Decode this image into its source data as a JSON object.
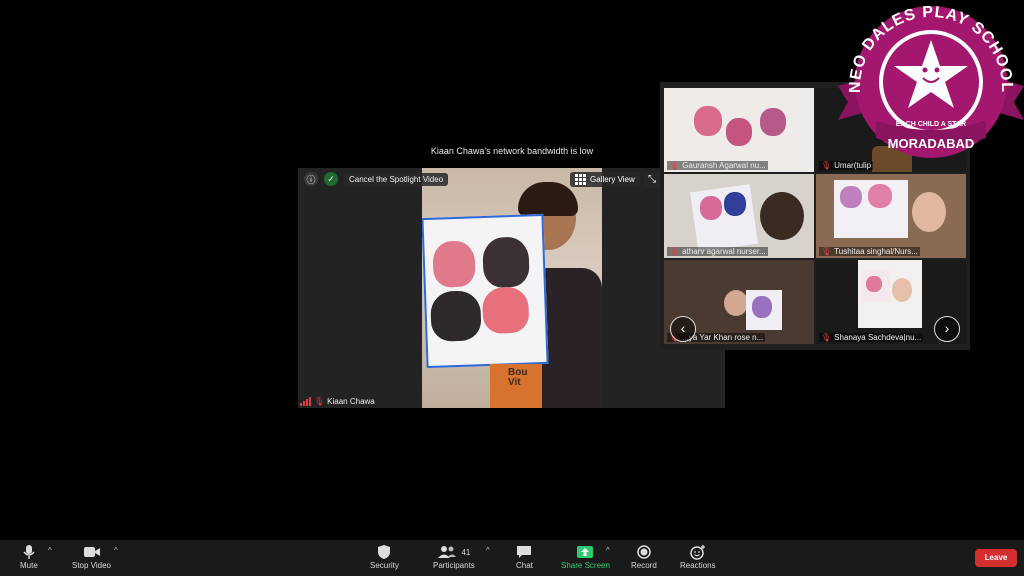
{
  "notice": "Kiaan Chawa's network bandwidth is low",
  "spotlight": {
    "cancel_label": "Cancel the Spotlight Video",
    "gallery_view_label": "Gallery View",
    "participant_name": "Kiaan Chawa",
    "book_text": "Bou\nVit"
  },
  "gallery": {
    "tiles": [
      {
        "name": "Gauransh Agarwal nu..."
      },
      {
        "name": "Umar(tulip"
      },
      {
        "name": "atharv agarwal nurser..."
      },
      {
        "name": "Tushitaa singhal/Nurs..."
      },
      {
        "name": "...ya Yar Khan rose n..."
      },
      {
        "name": "Shanaya Sachdeva|nu..."
      }
    ],
    "prev_label": "‹",
    "next_label": "›"
  },
  "badge": {
    "school_name": "NEO DALES PLAY SCHOOL",
    "tagline": "EACH CHILD A STAR",
    "city": "MORADABAD"
  },
  "toolbar": {
    "mute": "Mute",
    "stop_video": "Stop Video",
    "security": "Security",
    "participants": "Participants",
    "participants_count": "41",
    "chat": "Chat",
    "share_screen": "Share Screen",
    "record": "Record",
    "reactions": "Reactions",
    "leave": "Leave"
  },
  "colors": {
    "share_green": "#2ecc71",
    "leave_red": "#d32f2f",
    "badge_magenta": "#a3186e"
  }
}
